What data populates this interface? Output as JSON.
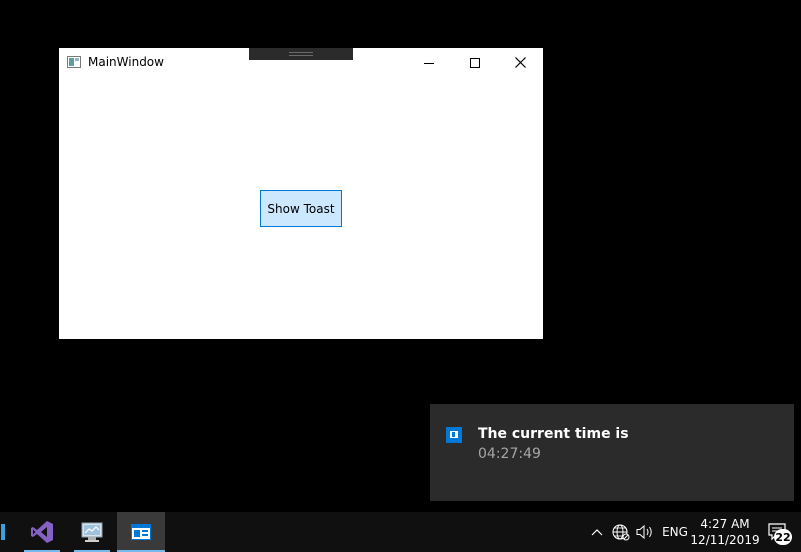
{
  "window": {
    "title": "MainWindow",
    "button_label": "Show Toast"
  },
  "toast": {
    "title": "The current time is",
    "body": "04:27:49"
  },
  "taskbar": {
    "apps": [
      {
        "icon": "visual-studio-icon"
      },
      {
        "icon": "control-panel-icon"
      },
      {
        "icon": "wpf-app-icon"
      }
    ],
    "tray": {
      "language": "ENG",
      "time": "4:27 AM",
      "date": "12/11/2019",
      "notification_count": "22"
    }
  },
  "colors": {
    "desktop": "#000000",
    "accent": "#0078d7",
    "button_bg": "#cce8ff",
    "toast_bg": "#2b2b2b",
    "taskbar_bg": "#101010"
  }
}
